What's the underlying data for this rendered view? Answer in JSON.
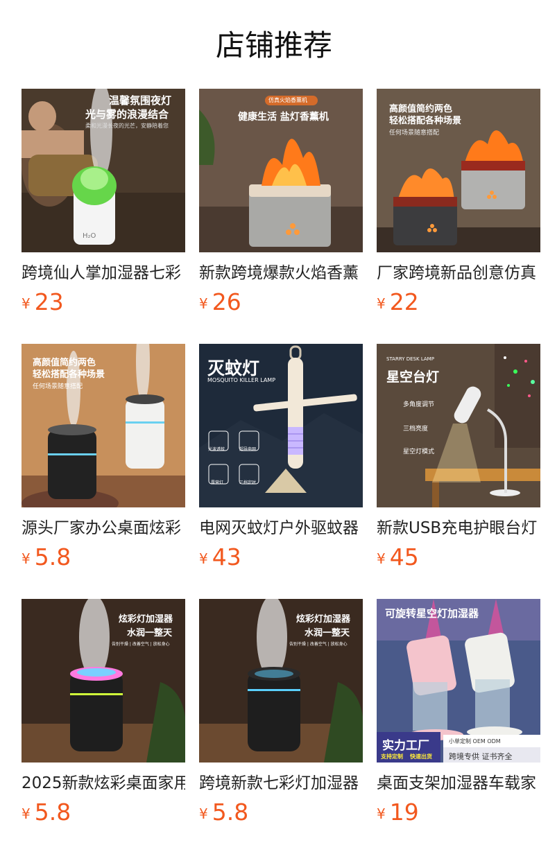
{
  "section_title": "店铺推荐",
  "currency": "¥",
  "products": [
    {
      "name": "跨境仙人掌加湿器七彩",
      "price": "23",
      "overlay": [
        "温馨氛围夜灯",
        "光与雾的浪漫结合",
        "柔和光漫长夜的光芒，安静陪着您"
      ]
    },
    {
      "name": "新款跨境爆款火焰香薰",
      "price": "26",
      "overlay": [
        "仿真火焰香薰机",
        "健康生活 盐灯香薰机"
      ]
    },
    {
      "name": "厂家跨境新品创意仿真",
      "price": "22",
      "overlay": [
        "高颜值简约两色",
        "轻松搭配各种场景",
        "任何场景随意搭配"
      ]
    },
    {
      "name": "源头厂家办公桌面炫彩",
      "price": "5.8",
      "overlay": [
        "高颜值简约两色",
        "轻松搭配各种场景",
        "任何场景随意搭配"
      ]
    },
    {
      "name": "电网灭蚊灯户外驱蚊器",
      "price": "43",
      "overlay": [
        "灭蚊灯",
        "MOSQUITO KILLER LAMP",
        "光波诱蚊",
        "超导电网",
        "露营灯",
        "三档定时"
      ]
    },
    {
      "name": "新款USB充电护眼台灯",
      "price": "45",
      "overlay": [
        "STARRY DESK LAMP",
        "星空台灯",
        "多角度调节",
        "三档亮度",
        "星空灯模式"
      ]
    },
    {
      "name": "2025新款炫彩桌面家用",
      "price": "5.8",
      "overlay": [
        "炫彩灯加湿器",
        "水润一整天",
        "告别干燥 | 改善空气 | 放松身心"
      ]
    },
    {
      "name": "跨境新款七彩灯加湿器",
      "price": "5.8",
      "overlay": [
        "炫彩灯加湿器",
        "水润一整天",
        "告别干燥 | 改善空气 | 放松身心"
      ]
    },
    {
      "name": "桌面支架加湿器车载家",
      "price": "19",
      "overlay": [
        "可旋转星空灯加湿器",
        "实力工厂",
        "小单定制 OEM ODM",
        "支持定制",
        "快速出货",
        "跨境专供 证书齐全"
      ]
    }
  ]
}
